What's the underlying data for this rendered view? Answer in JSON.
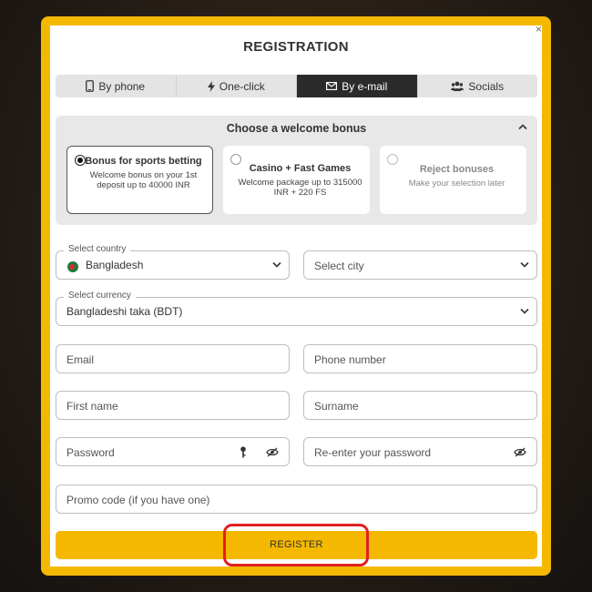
{
  "modal": {
    "title": "REGISTRATION",
    "close_glyph": "×"
  },
  "tabs": [
    {
      "label": "By phone",
      "icon": "phone-icon",
      "active": false
    },
    {
      "label": "One-click",
      "icon": "lightning-icon",
      "active": false
    },
    {
      "label": "By e-mail",
      "icon": "envelope-icon",
      "active": true
    },
    {
      "label": "Socials",
      "icon": "people-icon",
      "active": false
    }
  ],
  "bonus": {
    "title": "Choose a welcome bonus",
    "options": [
      {
        "name": "Bonus for sports betting",
        "desc": "Welcome bonus on your 1st deposit up to 40000 INR",
        "selected": true
      },
      {
        "name": "Casino + Fast Games",
        "desc": "Welcome package up to 315000 INR + 220 FS",
        "selected": false
      },
      {
        "name": "Reject bonuses",
        "desc": "Make your selection later",
        "selected": false
      }
    ]
  },
  "form": {
    "country": {
      "label": "Select country",
      "value": "Bangladesh"
    },
    "city": {
      "placeholder": "Select city"
    },
    "currency": {
      "label": "Select currency",
      "value": "Bangladeshi taka (BDT)"
    },
    "email": {
      "placeholder": "Email"
    },
    "phone": {
      "placeholder": "Phone number"
    },
    "first_name": {
      "placeholder": "First name"
    },
    "surname": {
      "placeholder": "Surname"
    },
    "password": {
      "placeholder": "Password"
    },
    "password_repeat": {
      "placeholder": "Re-enter your password"
    },
    "promo": {
      "placeholder": "Promo code (if you have one)"
    },
    "submit_label": "REGISTER"
  },
  "colors": {
    "accent": "#f5b800",
    "active_tab": "#2b2b2b",
    "highlight": "#e32020",
    "flag_green": "#1f7a3a",
    "flag_red": "#d32f2f"
  }
}
